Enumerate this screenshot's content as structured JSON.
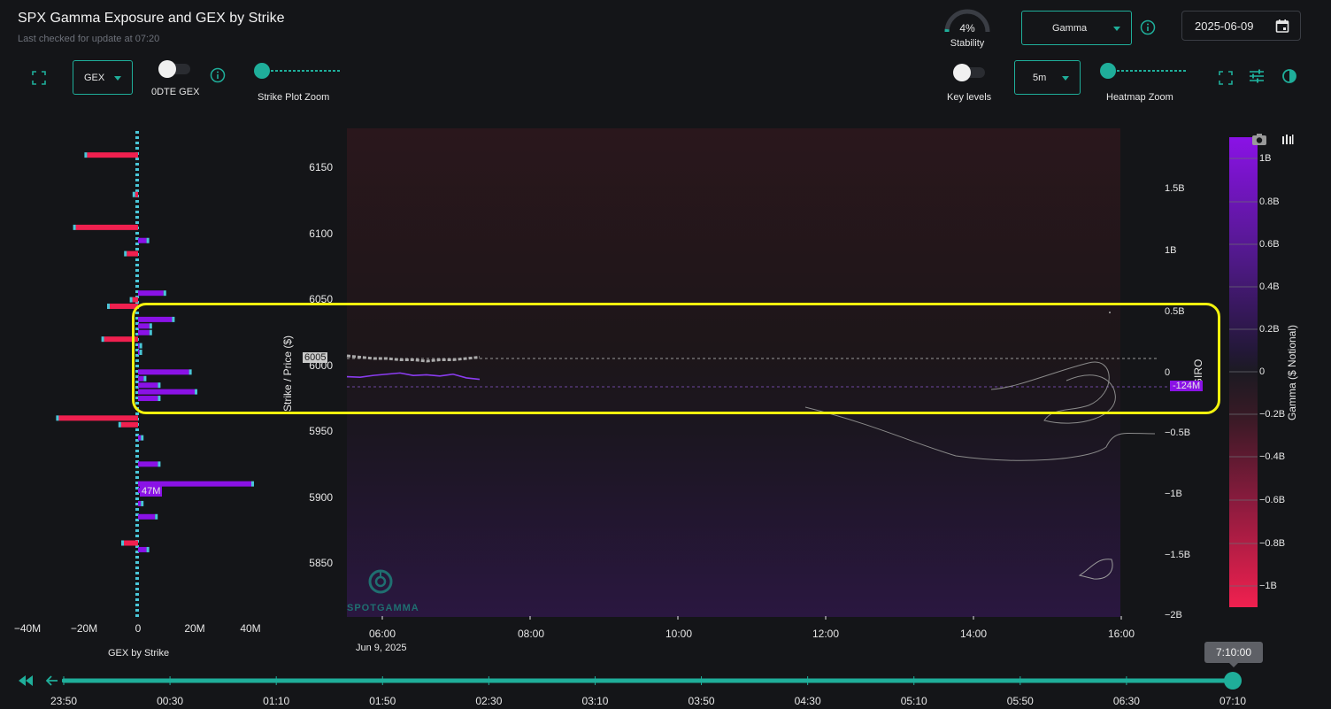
{
  "header": {
    "title": "SPX Gamma Exposure and GEX by Strike",
    "subtitle": "Last checked for update at 07:20",
    "stability_value": "4%",
    "stability_fraction": 0.04,
    "stability_label": "Stability",
    "metric_select": "Gamma",
    "date": "2025-06-09"
  },
  "left_controls": {
    "gex_select": "GEX",
    "zero_dte_label": "0DTE GEX",
    "strike_zoom_label": "Strike Plot Zoom"
  },
  "right_controls": {
    "key_levels_label": "Key levels",
    "interval_select": "5m",
    "heatmap_zoom_label": "Heatmap Zoom"
  },
  "colors": {
    "accent": "#1fae9a",
    "positive": "#8a12e6",
    "negative": "#f0204f",
    "highlight": "#f2f20e",
    "background": "#141518"
  },
  "icons": [
    "expand-icon",
    "info-icon",
    "calendar-icon",
    "sliders-icon",
    "contrast-icon",
    "camera-icon",
    "bars-icon",
    "rewind-icon",
    "arrow-left-icon",
    "spotgamma-logo-icon"
  ],
  "gex_chart": {
    "xlabel": "GEX by Strike",
    "x_ticks": [
      "−40M",
      "−20M",
      "0",
      "20M",
      "40M"
    ],
    "annotation": "47M"
  },
  "chart_data": [
    {
      "type": "bar",
      "title": "",
      "xlabel": "GEX by Strike",
      "ylabel": "",
      "orientation": "horizontal",
      "xlim": [
        -40,
        40
      ],
      "strikes": [
        6160,
        6130,
        6105,
        6095,
        6085,
        6055,
        6050,
        6045,
        6035,
        6030,
        6025,
        6020,
        6015,
        6010,
        5995,
        5990,
        5985,
        5980,
        5975,
        5960,
        5955,
        5945,
        5925,
        5910,
        5905,
        5895,
        5885,
        5865,
        5860
      ],
      "values": [
        -18,
        -1,
        -22,
        3,
        -4,
        9,
        -2,
        -10,
        12,
        4,
        4,
        -12,
        0.5,
        0.5,
        18,
        2,
        7,
        20,
        7,
        -28,
        -6,
        1,
        7,
        40,
        5,
        1,
        6,
        -5,
        3
      ]
    },
    {
      "type": "heatmap",
      "title": "",
      "xlabel": "",
      "ylabel": "Strike / Price ($)",
      "right_ylabel": "GIRO",
      "colorbar_label": "Gamma ($ Notional)",
      "x_ticks": [
        "06:00",
        "08:00",
        "10:00",
        "12:00",
        "14:00",
        "16:00"
      ],
      "x_sublabel": "Jun 9, 2025",
      "y_ticks": [
        6150,
        6100,
        6050,
        6000,
        5950,
        5900,
        5850
      ],
      "right_y_ticks": [
        "1.5B",
        "1B",
        "0.5B",
        "0",
        "−0.5B",
        "−1B",
        "−1.5B",
        "−2B"
      ],
      "colorbar_ticks": [
        "1B",
        "0.8B",
        "0.6B",
        "0.4B",
        "0.2B",
        "0",
        "−0.2B",
        "−0.4B",
        "−0.6B",
        "−0.8B",
        "−1B"
      ],
      "price_label": "6005",
      "giro_label": "-124M",
      "price_series": [
        6007,
        6006,
        6005,
        6005,
        6004,
        6004,
        6003,
        6004,
        6004,
        6005,
        6006
      ],
      "giro_series": [
        -80,
        -90,
        -60,
        -40,
        -20,
        -60,
        -50,
        -70,
        -40,
        -100,
        -124
      ]
    }
  ],
  "timeline": {
    "current": "7:10:00",
    "ticks": [
      "23:50",
      "00:30",
      "01:10",
      "01:50",
      "02:30",
      "03:10",
      "03:50",
      "04:30",
      "05:10",
      "05:50",
      "06:30",
      "07:10"
    ]
  }
}
